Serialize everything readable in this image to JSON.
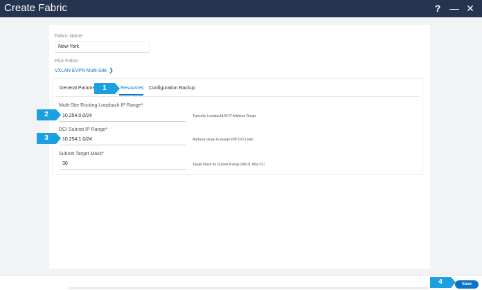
{
  "window": {
    "title": "Create Fabric",
    "help_icon": "?",
    "minimize_icon": "—",
    "close_icon": "✕"
  },
  "fabric_name": {
    "label": "Fabric Name",
    "value": "New-York"
  },
  "pick_fabric": {
    "label": "Pick Fabric",
    "link": "VXLAN EVPN Multi-Site",
    "chevron": "❯"
  },
  "tabs": [
    {
      "label": "General Parameters"
    },
    {
      "label": "Resources"
    },
    {
      "label": "Configuration Backup"
    }
  ],
  "fields": [
    {
      "label": "Multi-Site Routing Loopback IP Range",
      "required": "*",
      "value": "10.254.0.0/24",
      "hint": "Typically Loopback100 IP Address Range"
    },
    {
      "label": "DCI Subnet IP Range",
      "required": "*",
      "value": "10.254.1.0/24",
      "hint": "Address range to assign P2P DCI Links"
    },
    {
      "label": "Subnet Target Mask",
      "required": "*",
      "value": "30",
      "hint": "Target Mask for Subnet Range (Min:8, Max:31)"
    }
  ],
  "callouts": [
    "1",
    "2",
    "3",
    "4"
  ],
  "footer": {
    "save_label": "Save"
  }
}
